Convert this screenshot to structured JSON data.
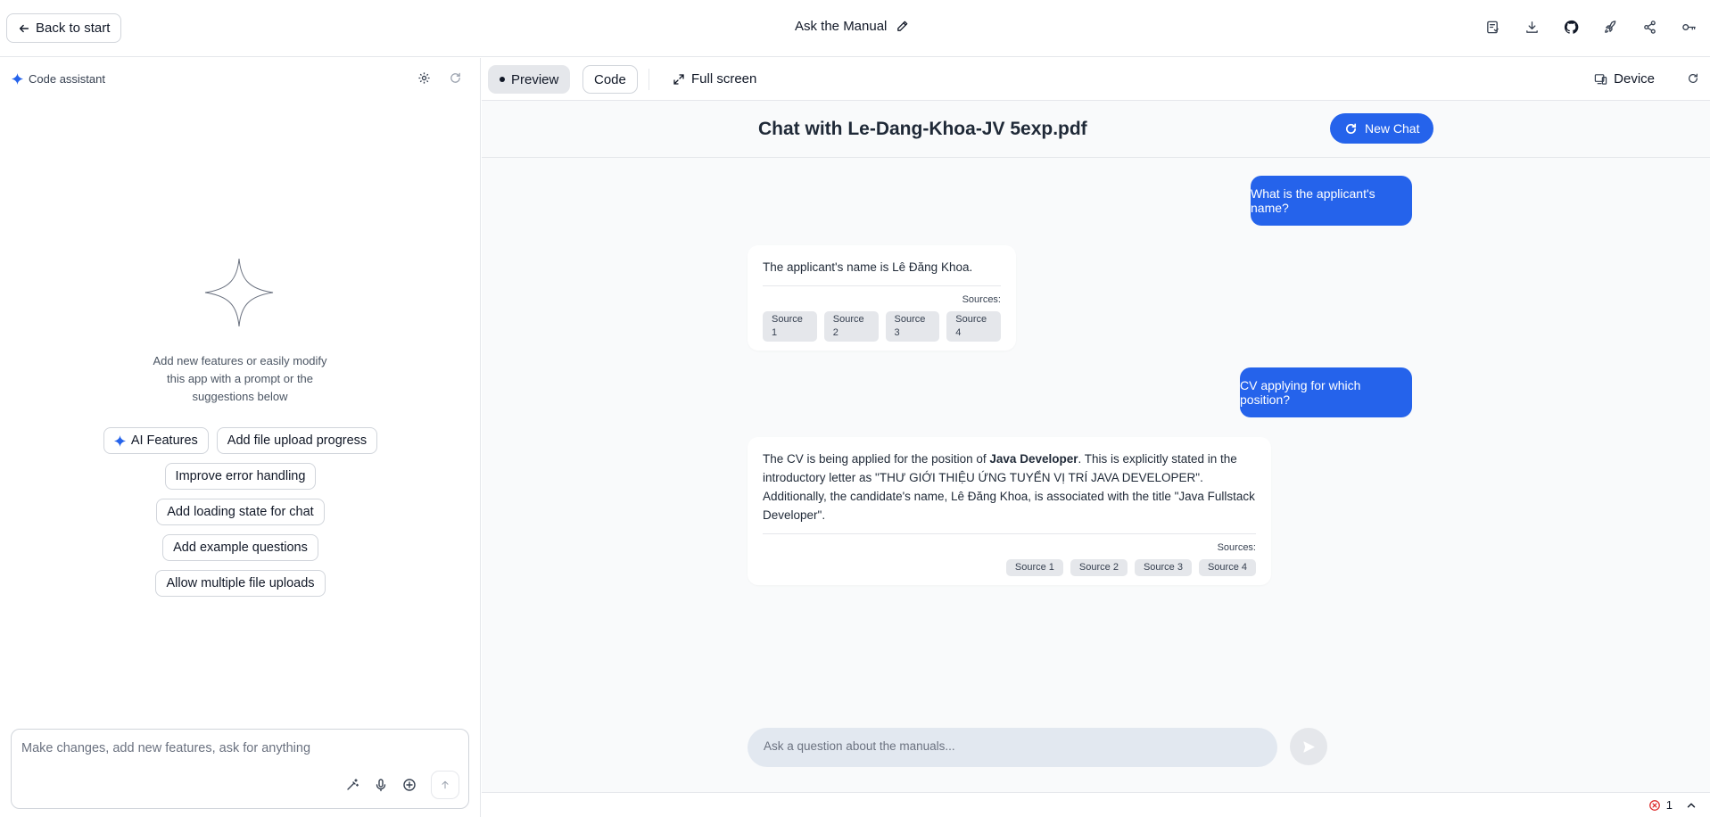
{
  "topbar": {
    "back_label": "Back to start",
    "app_title": "Ask the Manual",
    "icons": [
      "save-icon",
      "download-icon",
      "github-icon",
      "rocket-icon",
      "share-icon",
      "key-icon"
    ]
  },
  "assistant": {
    "header_label": "Code assistant",
    "intro_text": "Add new features or easily modify this app with a prompt or the suggestions below",
    "suggestions": {
      "ai_features": "AI Features",
      "file_upload_progress": "Add file upload progress",
      "error_handling": "Improve error handling",
      "loading_state": "Add loading state for chat",
      "example_questions": "Add example questions",
      "multiple_uploads": "Allow multiple file uploads"
    },
    "composer_placeholder": "Make changes, add new features, ask for anything"
  },
  "preview": {
    "tab_preview": "Preview",
    "tab_code": "Code",
    "fullscreen_label": "Full screen",
    "device_label": "Device"
  },
  "chat": {
    "title": "Chat with Le-Dang-Khoa-JV 5exp.pdf",
    "new_chat_label": "New Chat",
    "messages": [
      {
        "role": "user",
        "text": "What is the applicant's name?"
      },
      {
        "role": "assistant",
        "text": "The applicant's name is Lê Đăng Khoa.",
        "sources_label": "Sources:",
        "sources": [
          "Source 1",
          "Source 2",
          "Source 3",
          "Source 4"
        ]
      },
      {
        "role": "user",
        "text": "CV applying for which position?"
      },
      {
        "role": "assistant",
        "text_before": "The CV is being applied for the position of ",
        "text_bold": "Java Developer",
        "text_after": ". This is explicitly stated in the introductory letter as \"THƯ GIỚI THIỆU ỨNG TUYỂN VỊ TRÍ JAVA DEVELOPER\". Additionally, the candidate's name, Lê Đăng Khoa, is associated with the title \"Java Fullstack Developer\".",
        "sources_label": "Sources:",
        "sources": [
          "Source 1",
          "Source 2",
          "Source 3",
          "Source 4"
        ]
      }
    ],
    "input_placeholder": "Ask a question about the manuals..."
  },
  "status": {
    "error_count": "1"
  },
  "colors": {
    "accent": "#2563eb",
    "error": "#dc2626"
  }
}
